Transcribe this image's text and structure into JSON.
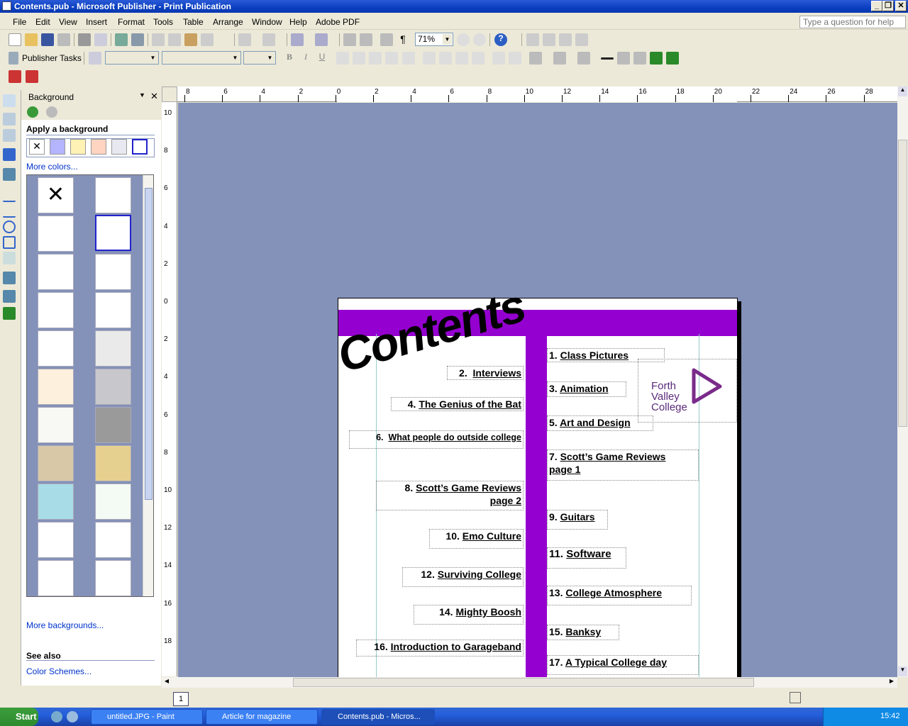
{
  "window": {
    "title": "Contents.pub - Microsoft Publisher - Print Publication"
  },
  "menu": [
    "File",
    "Edit",
    "View",
    "Insert",
    "Format",
    "Tools",
    "Table",
    "Arrange",
    "Window",
    "Help",
    "Adobe PDF"
  ],
  "ask_placeholder": "Type a question for help",
  "toolbar": {
    "zoom": "71%",
    "publisher_tasks": "Publisher Tasks"
  },
  "taskpane": {
    "title": "Background",
    "apply_heading": "Apply a background",
    "more_colors": "More colors...",
    "more_backgrounds": "More backgrounds...",
    "see_also": "See also",
    "color_schemes": "Color Schemes...",
    "swatch_colors": [
      "#FFFFFF",
      "#B4B4FF",
      "#FFF2B4",
      "#FFD4C0",
      "#E8E8F0",
      "#FFFFFF"
    ]
  },
  "ruler": {
    "h": [
      "8",
      "6",
      "4",
      "2",
      "0",
      "2",
      "4",
      "6",
      "8",
      "10",
      "12",
      "14",
      "16",
      "18",
      "20",
      "22",
      "24",
      "26",
      "28"
    ],
    "v": [
      "10",
      "8",
      "6",
      "4",
      "2",
      "0",
      "2",
      "4",
      "6",
      "8",
      "10",
      "12",
      "14",
      "16",
      "18"
    ]
  },
  "page": {
    "title": "Contents",
    "accent": "#9400CF",
    "logo": {
      "line1": "Forth",
      "line2": "Valley",
      "line3": "College"
    },
    "left_items": [
      {
        "num": "2.",
        "text": "Interviews"
      },
      {
        "num": "4.",
        "text": "The Genius of the Bat"
      },
      {
        "num": "6.",
        "text": "What people do outside college"
      },
      {
        "num": "8.",
        "text": "Scott’s Game Reviews",
        "text2": "page 2"
      },
      {
        "num": "10.",
        "text": "Emo Culture"
      },
      {
        "num": "12.",
        "text": "Surviving College"
      },
      {
        "num": "14.",
        "text": "Mighty Boosh"
      },
      {
        "num": "16.",
        "text": "Introduction to Garageband"
      }
    ],
    "right_items": [
      {
        "num": "1.",
        "text": "Class Pictures"
      },
      {
        "num": "3.",
        "text": "Animation"
      },
      {
        "num": "5.",
        "text": "Art and Design"
      },
      {
        "num": "7.",
        "text": "Scott’s Game Reviews",
        "text2": "page 1"
      },
      {
        "num": "9.",
        "text": "Guitars"
      },
      {
        "num": "11.",
        "text": "Software"
      },
      {
        "num": "13.",
        "text": "College Atmosphere"
      },
      {
        "num": "15.",
        "text": "Banksy"
      },
      {
        "num": "17.",
        "text": "A Typical College day"
      }
    ]
  },
  "status": {
    "page_number": "1"
  },
  "taskbar": {
    "start": "Start",
    "tasks": [
      "untitled.JPG - Paint",
      "Article for magazine",
      "Contents.pub - Micros..."
    ],
    "clock": "15:42"
  }
}
